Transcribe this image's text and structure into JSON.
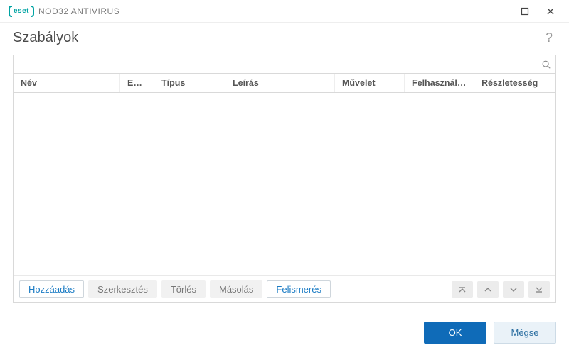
{
  "brand": {
    "logo_text": "eset",
    "product": "NOD32 ANTIVIRUS"
  },
  "page": {
    "title": "Szabályok"
  },
  "search": {
    "value": "",
    "placeholder": ""
  },
  "columns": {
    "name": "Név",
    "enabled": "Enge...",
    "type": "Típus",
    "description": "Leírás",
    "action": "Művelet",
    "users": "Felhasználók",
    "detail": "Részletesség"
  },
  "buttons": {
    "add": "Hozzáadás",
    "edit": "Szerkesztés",
    "delete": "Törlés",
    "copy": "Másolás",
    "detect": "Felismerés"
  },
  "footer": {
    "ok": "OK",
    "cancel": "Mégse"
  },
  "rows": []
}
